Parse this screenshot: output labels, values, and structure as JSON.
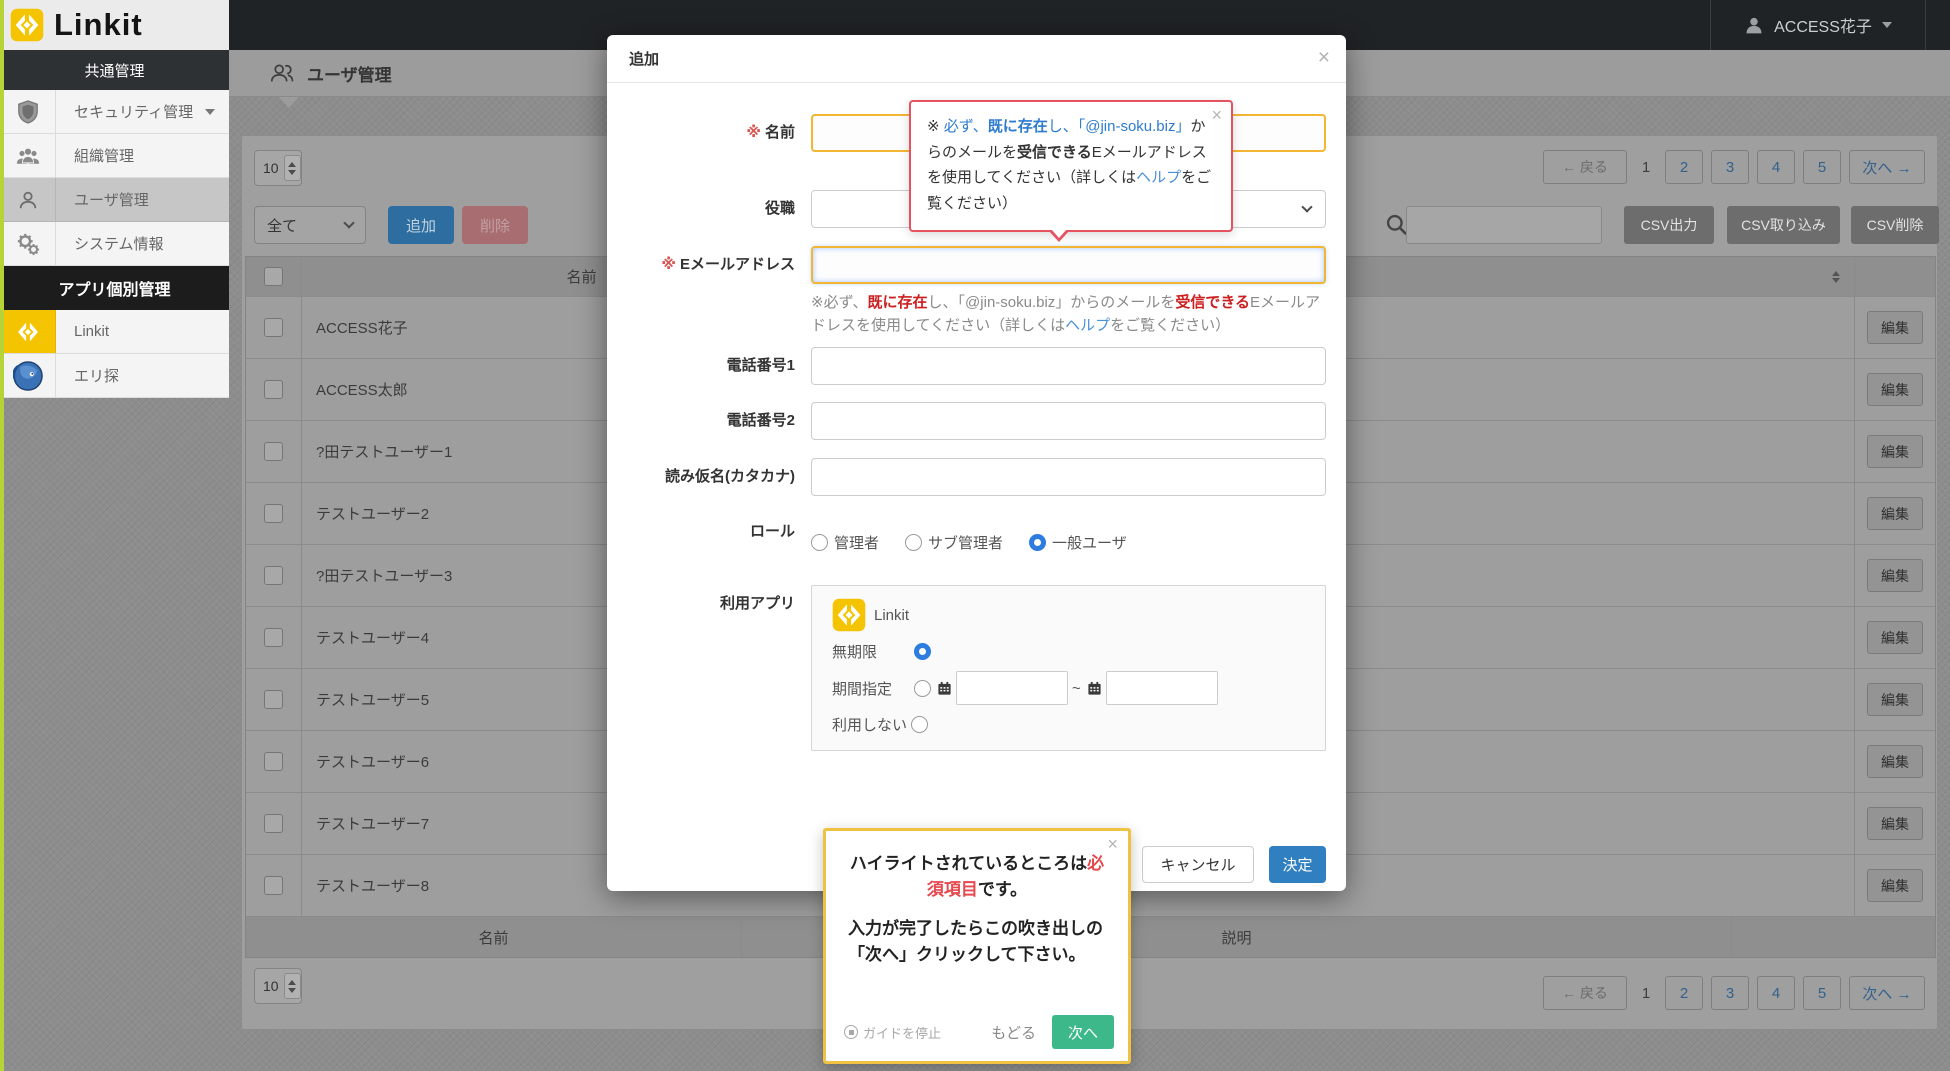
{
  "colors": {
    "accent_blue": "#337ab7",
    "danger_red": "#d9534f",
    "brand_yellow": "#f5c400",
    "guide_green": "#3cb88a",
    "highlight_yellow": "#f2b632",
    "tooltip_red_border": "#e65260",
    "guide_yellow_border": "#f0c243",
    "link_blue": "#2e7bcf"
  },
  "header": {
    "logo_text": "Linkit",
    "user_name": "ACCESS花子"
  },
  "sidebar": {
    "section_common": "共通管理",
    "items": [
      {
        "label": "セキュリティ管理"
      },
      {
        "label": "組織管理"
      },
      {
        "label": "ユーザ管理"
      },
      {
        "label": "システム情報"
      }
    ],
    "section_apps": "アプリ個別管理",
    "apps": [
      {
        "label": "Linkit"
      },
      {
        "label": "エリ探"
      }
    ]
  },
  "content": {
    "page_title": "ユーザ管理",
    "page_size": "10",
    "filter_all": "全て",
    "add_label": "追加",
    "delete_label": "削除",
    "csv_export": "CSV出力",
    "csv_import": "CSV取り込み",
    "csv_delete": "CSV削除",
    "pagination": {
      "prev": "← 戻る",
      "pages": [
        "1",
        "2",
        "3",
        "4",
        "5"
      ],
      "next": "次へ →",
      "current": "1"
    },
    "table": {
      "name_header": "名前",
      "edit_label": "編集",
      "rows": [
        "ACCESS花子",
        "ACCESS太郎",
        "?田テストユーザー1",
        "テストユーザー2",
        "?田テストユーザー3",
        "テストユーザー4",
        "テストユーザー5",
        "テストユーザー6",
        "テストユーザー7",
        "テストユーザー8"
      ],
      "footer_name": "名前",
      "footer_desc": "説明"
    }
  },
  "modal": {
    "title": "追加",
    "close": "×",
    "required_mark": "※",
    "labels": {
      "name": "名前",
      "position": "役職",
      "email": "Eメールアドレス",
      "phone1": "電話番号1",
      "phone2": "電話番号2",
      "kana": "読み仮名(カタカナ)",
      "role": "ロール",
      "apps": "利用アプリ"
    },
    "email_note": {
      "p1": "※必ず、",
      "p2": "既に存在",
      "p3": "し、「@jin-soku.biz」からのメールを",
      "p4": "受信できる",
      "p5": "Eメールアドレスを使用してください（詳しくは",
      "p6": "ヘルプ",
      "p7": "をご覧ください）"
    },
    "role_options": [
      "管理者",
      "サブ管理者",
      "一般ユーザ"
    ],
    "role_selected": "一般ユーザ",
    "app_box": {
      "app_name": "Linkit",
      "opt_unlimited": "無期限",
      "opt_period": "期間指定",
      "opt_disabled": "利用しない",
      "tilde": "~"
    },
    "cancel_label": "キャンセル",
    "submit_label": "決定"
  },
  "email_tooltip": {
    "close": "×",
    "s1": "※ ",
    "s2": "必ず、",
    "s3": "既に存在",
    "s4": "し、「@jin-soku.biz」",
    "s5": "からのメールを",
    "s6": "受信できる",
    "s7": "Eメールアドレスを使用してください（詳しくは",
    "s8": "ヘルプ",
    "s9": "をご覧ください）"
  },
  "guide_tooltip": {
    "close": "×",
    "line1_a": "ハイライトされているところは",
    "line1_b": "必須項目",
    "line1_c": "です。",
    "line2": "入力が完了したらこの吹き出しの「次へ」クリックして下さい。",
    "stop_label": "ガイドを停止",
    "back_label": "もどる",
    "next_label": "次へ"
  }
}
